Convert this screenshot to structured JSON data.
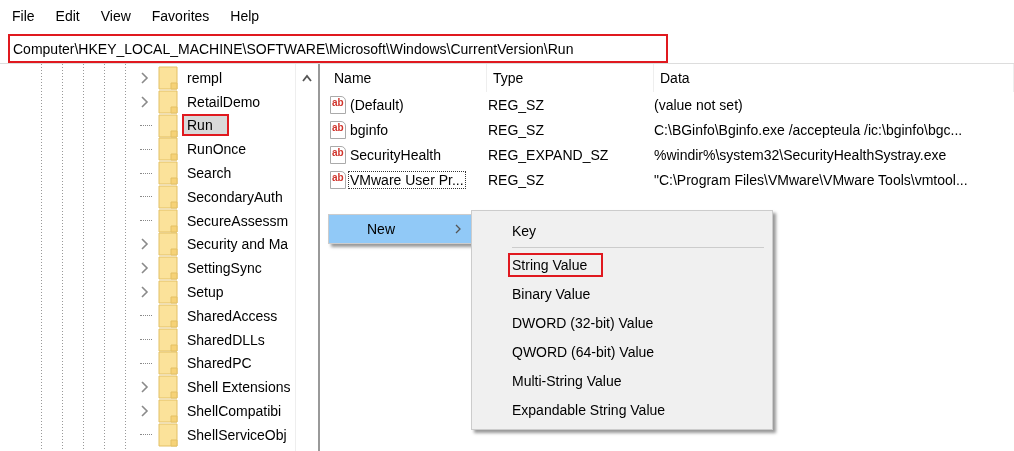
{
  "menu_bar": [
    "File",
    "Edit",
    "View",
    "Favorites",
    "Help"
  ],
  "address_bar": {
    "value": "Computer\\HKEY_LOCAL_MACHINE\\SOFTWARE\\Microsoft\\Windows\\CurrentVersion\\Run",
    "highlighted": true
  },
  "tree": {
    "items": [
      {
        "label": "rempl",
        "expandable": true,
        "selected": false,
        "highlighted": false
      },
      {
        "label": "RetailDemo",
        "expandable": true,
        "selected": false,
        "highlighted": false
      },
      {
        "label": "Run",
        "expandable": false,
        "selected": true,
        "highlighted": true
      },
      {
        "label": "RunOnce",
        "expandable": false,
        "selected": false,
        "highlighted": false
      },
      {
        "label": "Search",
        "expandable": false,
        "selected": false,
        "highlighted": false
      },
      {
        "label": "SecondaryAuth",
        "expandable": false,
        "selected": false,
        "highlighted": false
      },
      {
        "label": "SecureAssessm",
        "expandable": false,
        "selected": false,
        "highlighted": false
      },
      {
        "label": "Security and Ma",
        "expandable": true,
        "selected": false,
        "highlighted": false
      },
      {
        "label": "SettingSync",
        "expandable": true,
        "selected": false,
        "highlighted": false
      },
      {
        "label": "Setup",
        "expandable": true,
        "selected": false,
        "highlighted": false
      },
      {
        "label": "SharedAccess",
        "expandable": false,
        "selected": false,
        "highlighted": false
      },
      {
        "label": "SharedDLLs",
        "expandable": false,
        "selected": false,
        "highlighted": false
      },
      {
        "label": "SharedPC",
        "expandable": false,
        "selected": false,
        "highlighted": false
      },
      {
        "label": "Shell Extensions",
        "expandable": true,
        "selected": false,
        "highlighted": false
      },
      {
        "label": "ShellCompatibi",
        "expandable": true,
        "selected": false,
        "highlighted": false
      },
      {
        "label": "ShellServiceObj",
        "expandable": false,
        "selected": false,
        "highlighted": false
      }
    ]
  },
  "values_table": {
    "columns": [
      "Name",
      "Type",
      "Data"
    ],
    "rows": [
      {
        "icon_text": "ab",
        "name": "(Default)",
        "type": "REG_SZ",
        "data": "(value not set)",
        "focused": false
      },
      {
        "icon_text": "ab",
        "name": "bginfo",
        "type": "REG_SZ",
        "data": "C:\\BGinfo\\Bginfo.exe /accepteula /ic:\\bginfo\\bgc...",
        "focused": false
      },
      {
        "icon_text": "ab",
        "name": "SecurityHealth",
        "type": "REG_EXPAND_SZ",
        "data": "%windir%\\system32\\SecurityHealthSystray.exe",
        "focused": false
      },
      {
        "icon_text": "ab",
        "name": "VMware User Pr...",
        "type": "REG_SZ",
        "data": "\"C:\\Program Files\\VMware\\VMware Tools\\vmtool...",
        "focused": true
      }
    ]
  },
  "context_menu": {
    "item": {
      "label": "New",
      "selected": true
    },
    "submenu": [
      {
        "kind": "item",
        "label": "Key",
        "highlighted": false
      },
      {
        "kind": "separator"
      },
      {
        "kind": "item",
        "label": "String Value",
        "highlighted": true
      },
      {
        "kind": "item",
        "label": "Binary Value",
        "highlighted": false
      },
      {
        "kind": "item",
        "label": "DWORD (32-bit) Value",
        "highlighted": false
      },
      {
        "kind": "item",
        "label": "QWORD (64-bit) Value",
        "highlighted": false
      },
      {
        "kind": "item",
        "label": "Multi-String Value",
        "highlighted": false
      },
      {
        "kind": "item",
        "label": "Expandable String Value",
        "highlighted": false
      }
    ]
  }
}
